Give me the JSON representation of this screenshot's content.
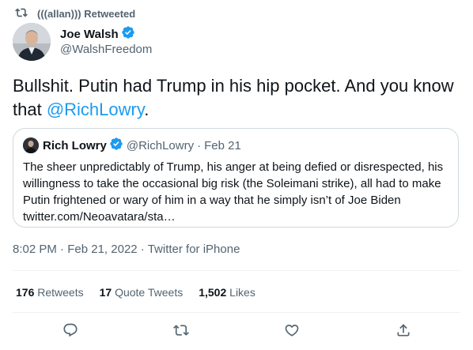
{
  "retweet": {
    "label": "(((allan))) Retweeted"
  },
  "author": {
    "name": "Joe Walsh",
    "handle": "@WalshFreedom",
    "verified": true
  },
  "tweet": {
    "text_before_mention": "Bullshit. Putin had Trump in his hip pocket. And you know that ",
    "mention": "@RichLowry",
    "text_after_mention": "."
  },
  "quote": {
    "name": "Rich Lowry",
    "handle": "@RichLowry",
    "separator": "·",
    "date": "Feb 21",
    "text": "The sheer unpredictably of Trump, his anger at being defied or disrespected, his willingness to take the occasional big risk (the Soleimani strike), all had to make Putin frightened or wary of him in a way that he simply isn’t of Joe Biden twitter.com/Neoavatara/sta…"
  },
  "meta": {
    "time": "8:02 PM",
    "separator": "·",
    "date": "Feb 21, 2022",
    "source": "Twitter for iPhone"
  },
  "stats": {
    "retweets_count": "176",
    "retweets_label": "Retweets",
    "quotes_count": "17",
    "quotes_label": "Quote Tweets",
    "likes_count": "1,502",
    "likes_label": "Likes"
  },
  "actions": {
    "reply_icon": "reply-icon",
    "retweet_icon": "retweet-icon",
    "like_icon": "heart-icon",
    "share_icon": "share-icon"
  },
  "colors": {
    "accent": "#1d9bf0",
    "secondary_text": "#536471",
    "primary_text": "#0f1419",
    "border": "#cfd9de"
  }
}
